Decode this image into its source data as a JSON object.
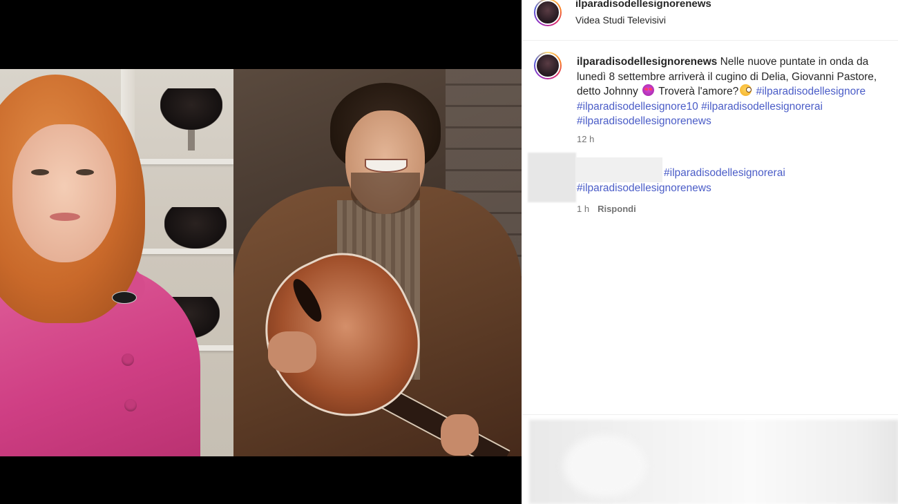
{
  "post": {
    "username": "ilparadisodellesignorenews",
    "location": "Videa Studi Televisivi"
  },
  "caption": {
    "username": "ilparadisodellesignorenews",
    "text_part1": " Nelle nuove puntate in onda da lunedì 8 settembre arriverà il cugino di Delia, Giovanni Pastore, detto Johnny ",
    "emoji1": "smiling-face-with-heart-eyes",
    "text_part2": " Troverà l'amore?",
    "emoji2": "face-with-monocle",
    "hashtags": [
      "#ilparadisodellesignore",
      "#ilparadisodellesignore10",
      "#ilparadisodellesignorerai",
      "#ilparadisodellesignorenews"
    ],
    "time": "12 h"
  },
  "comment": {
    "hashtags": [
      "#ilparadisodellesignorerai",
      "#ilparadisodellesignorenews"
    ],
    "time": "1 h",
    "reply_label": "Rispondi"
  },
  "colors": {
    "hashtag": "#4a5cc7",
    "text": "#262626",
    "muted": "#737373",
    "media_background": "#000000"
  }
}
